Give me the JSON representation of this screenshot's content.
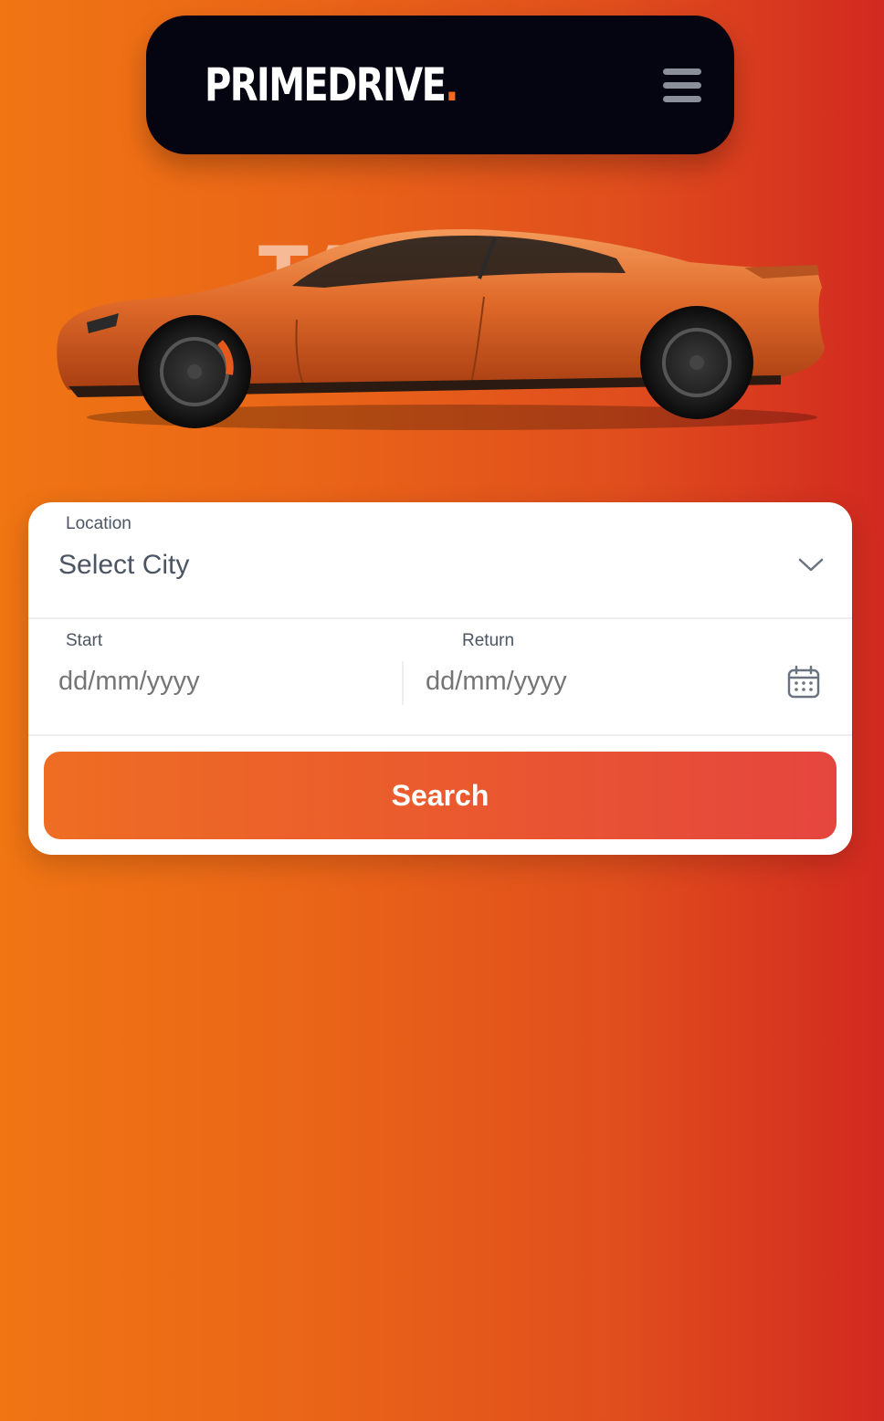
{
  "header": {
    "logo_text": "PRIMEDRIVE",
    "logo_dot": ".",
    "menu_icon": "hamburger-menu-icon"
  },
  "hero": {
    "image": "orange-sports-sedan",
    "watermark_text": "TAYCAN"
  },
  "search_form": {
    "location_label": "Location",
    "location_value": "Select City",
    "location_icon": "chevron-down-icon",
    "start_label": "Start",
    "start_placeholder": "dd/mm/yyyy",
    "return_label": "Return",
    "return_placeholder": "dd/mm/yyyy",
    "calendar_icon": "calendar-icon",
    "search_label": "Search"
  },
  "colors": {
    "accent": "#f26a1e",
    "navbar_bg": "#050511",
    "gradient_left": "#f07513",
    "gradient_right": "#d22920"
  }
}
